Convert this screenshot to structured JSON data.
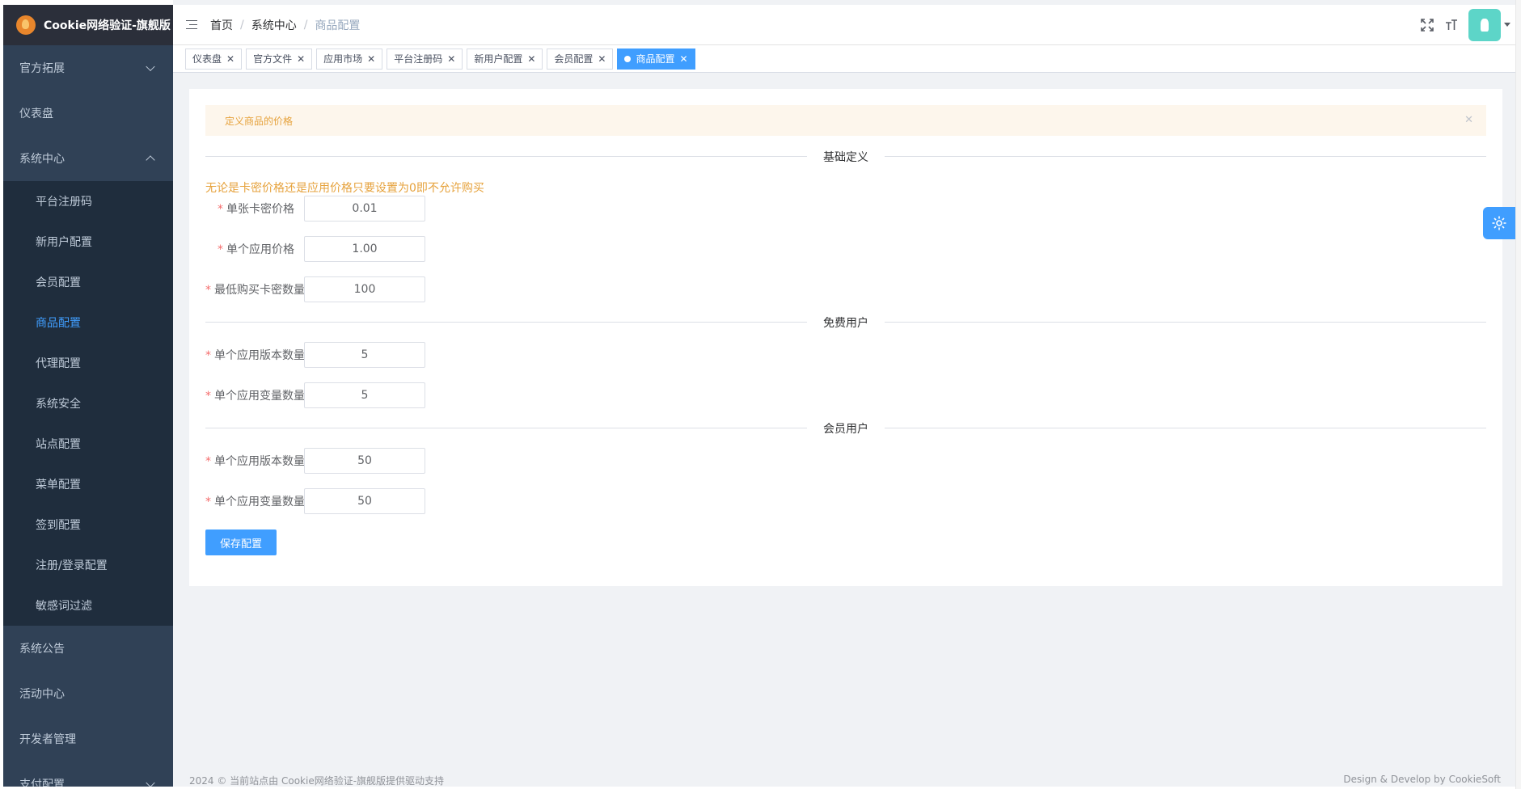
{
  "app": {
    "title": "Cookie网络验证-旗舰版"
  },
  "sidebar": {
    "items": [
      {
        "label": "官方拓展",
        "arrow": "down"
      },
      {
        "label": "仪表盘"
      },
      {
        "label": "系统中心",
        "arrow": "up"
      }
    ],
    "submenu": [
      {
        "label": "平台注册码",
        "active": false
      },
      {
        "label": "新用户配置",
        "active": false
      },
      {
        "label": "会员配置",
        "active": false
      },
      {
        "label": "商品配置",
        "active": true
      },
      {
        "label": "代理配置",
        "active": false
      },
      {
        "label": "系统安全",
        "active": false
      },
      {
        "label": "站点配置",
        "active": false
      },
      {
        "label": "菜单配置",
        "active": false
      },
      {
        "label": "签到配置",
        "active": false
      },
      {
        "label": "注册/登录配置",
        "active": false
      },
      {
        "label": "敏感词过滤",
        "active": false
      }
    ],
    "bottom_items": [
      {
        "label": "系统公告"
      },
      {
        "label": "活动中心"
      },
      {
        "label": "开发者管理"
      },
      {
        "label": "支付配置",
        "arrow": "down"
      }
    ]
  },
  "header": {
    "breadcrumb": [
      "首页",
      "系统中心",
      "商品配置"
    ],
    "separator": "/",
    "icons": [
      "fullscreen-icon",
      "font-size-icon"
    ]
  },
  "tags": [
    {
      "label": "仪表盘",
      "active": false
    },
    {
      "label": "官方文件",
      "active": false
    },
    {
      "label": "应用市场",
      "active": false
    },
    {
      "label": "平台注册码",
      "active": false
    },
    {
      "label": "新用户配置",
      "active": false
    },
    {
      "label": "会员配置",
      "active": false
    },
    {
      "label": "商品配置",
      "active": true
    }
  ],
  "tag_close": "✕",
  "page": {
    "alert": "定义商品的价格",
    "alert_close": "✕",
    "sections": {
      "basic": "基础定义",
      "free": "免费用户",
      "member": "会员用户"
    },
    "warning": "无论是卡密价格还是应用价格只要设置为0即不允许购买",
    "fields": {
      "card_price": {
        "label": "单张卡密价格",
        "value": "0.01"
      },
      "app_price": {
        "label": "单个应用价格",
        "value": "1.00"
      },
      "min_cards": {
        "label": "最低购买卡密数量",
        "value": "100"
      },
      "free_versions": {
        "label": "单个应用版本数量",
        "value": "5"
      },
      "free_variables": {
        "label": "单个应用变量数量",
        "value": "5"
      },
      "member_versions": {
        "label": "单个应用版本数量",
        "value": "50"
      },
      "member_variables": {
        "label": "单个应用变量数量",
        "value": "50"
      }
    },
    "required_mark": "*",
    "save_label": "保存配置"
  },
  "footer": {
    "left": "2024 © 当前站点由 Cookie网络验证-旗舰版提供驱动支持",
    "right": "Design & Develop by CookieSoft"
  },
  "colors": {
    "sidebar_bg": "#304156",
    "submenu_bg": "#1f2d3d",
    "accent": "#409eff",
    "warning": "#e6a23c"
  }
}
